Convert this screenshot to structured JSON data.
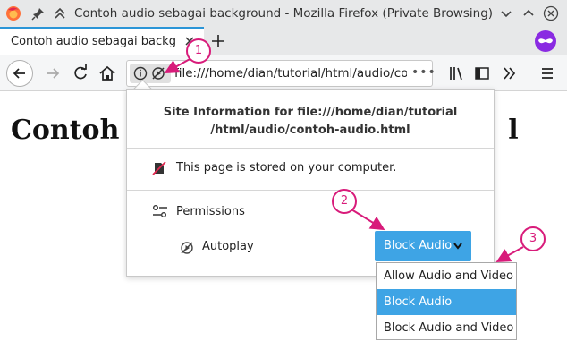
{
  "window": {
    "title": "Contoh audio sebagai background - Mozilla Firefox (Private Browsing)"
  },
  "tab": {
    "label": "Contoh audio sebagai backgr"
  },
  "urlbar": {
    "url": "file:///home/dian/tutorial/html/audio/co",
    "more": "•••"
  },
  "page": {
    "heading_left": "Contoh a",
    "heading_right": "l"
  },
  "site_info": {
    "header_line1": "Site Information for file:///home/dian/tutorial",
    "header_line2": "/html/audio/contoh-audio.html",
    "stored_text": "This page is stored on your computer.",
    "permissions_label": "Permissions",
    "autoplay_label": "Autoplay",
    "autoplay_value": "Block Audio"
  },
  "autoplay_options": [
    "Allow Audio and Video",
    "Block Audio",
    "Block Audio and Video"
  ],
  "annotations": [
    "1",
    "2",
    "3"
  ],
  "colors": {
    "accent": "#3ea4e5",
    "annotation": "#d81b7a",
    "private": "#8a2be2"
  }
}
